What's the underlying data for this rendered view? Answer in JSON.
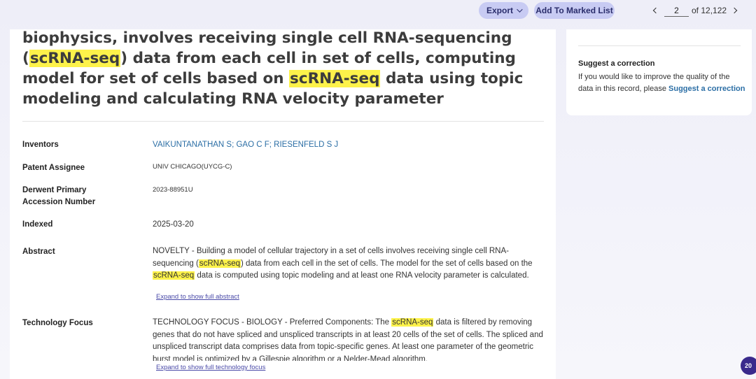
{
  "toolbar": {
    "export_label": "Export",
    "marked_list_label": "Add To Marked List",
    "pager": {
      "current": "2",
      "of_label": "of 12,122"
    }
  },
  "record": {
    "title_parts": [
      "biophysics, involves receiving single cell RNA-sequencing (",
      "scRNA-seq",
      ") data from each cell in set of cells, computing model for set of cells based on ",
      "scRNA-seq",
      " data using topic modeling and calculating RNA velocity parameter"
    ],
    "fields": {
      "inventors": {
        "label": "Inventors",
        "value": "VAIKUNTANATHAN S; GAO C F; RIESENFELD S J"
      },
      "assignee": {
        "label": "Patent Assignee",
        "value": "UNIV CHICAGO(UYCG-C)"
      },
      "accession": {
        "label": "Derwent Primary Accession Number",
        "value": "2023-88951U"
      },
      "indexed": {
        "label": "Indexed",
        "value": "2025-03-20"
      },
      "abstract": {
        "label": "Abstract",
        "parts": [
          "NOVELTY - Building a model of cellular trajectory in a set of cells involves receiving single cell RNA-sequencing (",
          "scRNA-seq",
          ") data from each cell in the set of cells. The model for the set of cells based on the ",
          "scRNA-seq",
          " data is computed using topic modeling and at least one RNA velocity parameter is calculated."
        ],
        "expand_label": "Expand to show full abstract"
      },
      "tech_focus": {
        "label": "Technology Focus",
        "parts": [
          "TECHNOLOGY FOCUS - BIOLOGY - Preferred Components: The ",
          "scRNA-seq",
          " data is filtered by removing genes that do not have spliced and unspliced transcripts in at least 20 cells of the set of cells. The spliced and unspliced transcript data comprises data from topic-specific genes. At least one parameter of the geometric burst model is optimized by a Gillespie algorithm or a Nelder-Mead algorithm."
        ],
        "expand_label": "Expand to show full technology focus"
      }
    }
  },
  "sidebar": {
    "correction_title": "Suggest a correction",
    "correction_text": "If you would like to improve the quality of the data in this record, please ",
    "correction_link": "Suggest a correction"
  },
  "badge": {
    "count": "20"
  },
  "colors": {
    "accent_pill": "#c8cbf3",
    "highlight": "#fdf24a",
    "link": "#2b6ea5",
    "badge": "#3a2a8c"
  }
}
